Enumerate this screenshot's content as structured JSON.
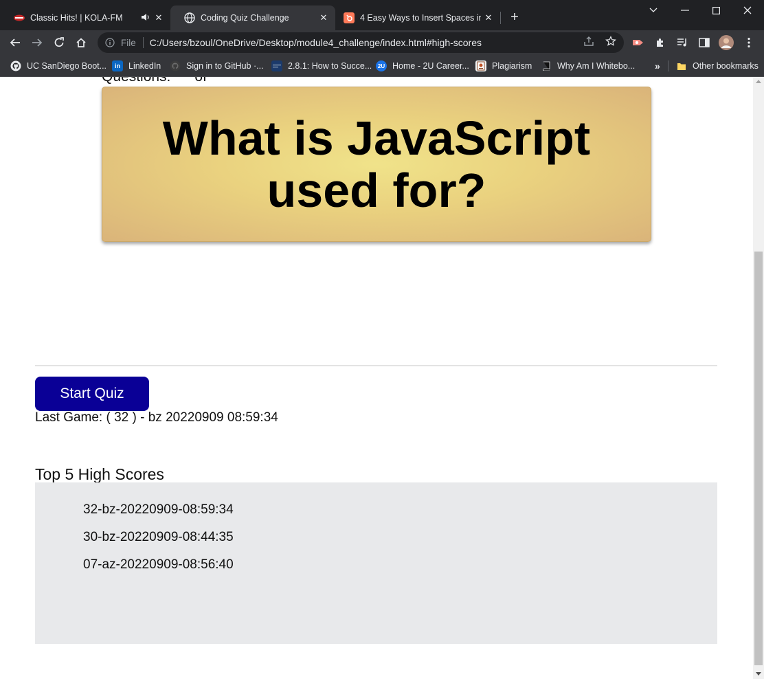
{
  "tabs": [
    {
      "title": "Classic Hits! | KOLA-FM",
      "active": false,
      "audio": true,
      "favicon": "kola-fm-icon"
    },
    {
      "title": "Coding Quiz Challenge",
      "active": true,
      "favicon": "globe-icon"
    },
    {
      "title": "4 Easy Ways to Insert Spaces in H",
      "active": false,
      "favicon": "hubspot-icon"
    }
  ],
  "address_bar": {
    "scheme_label": "File",
    "url": "C:/Users/bzoul/OneDrive/Desktop/module4_challenge/index.html#high-scores"
  },
  "bookmarks": [
    {
      "label": "UC SanDiego Boot...",
      "icon": "github-dark-icon"
    },
    {
      "label": "LinkedIn",
      "icon": "linkedin-icon"
    },
    {
      "label": "Sign in to GitHub ·...",
      "icon": "github-icon"
    },
    {
      "label": "2.8.1: How to Succe...",
      "icon": "canvas-icon"
    },
    {
      "label": "Home - 2U Career...",
      "icon": "2u-icon",
      "icon_text": "2U"
    },
    {
      "label": "Plagiarism",
      "icon": "plagiarism-icon"
    },
    {
      "label": "Why Am I Whitebo...",
      "icon": "book-icon"
    }
  ],
  "bookmarks_overflow": "»",
  "other_bookmarks": "Other bookmarks",
  "page": {
    "questions_counter": "Questions:      of",
    "question": "What is JavaScript used for?",
    "start_button": "Start Quiz",
    "last_game": "Last Game: ( 32 ) - bz 20220909 08:59:34",
    "high_scores_heading": "Top 5 High Scores",
    "high_scores": [
      "32-bz-20220909-08:59:34",
      "30-bz-20220909-08:44:35",
      "07-az-20220909-08:56:40"
    ]
  },
  "colors": {
    "start_button": "#0a0096",
    "card_center": "#f0e38a",
    "card_edge": "#dab47a",
    "scores_panel": "#e8e9eb"
  }
}
